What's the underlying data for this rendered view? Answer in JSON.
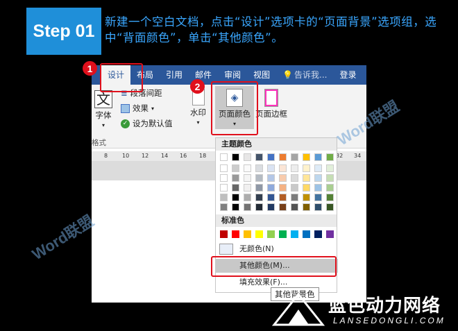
{
  "step": {
    "badge": "Step 01",
    "instruction": "新建一个空白文档，点击“设计”选项卡的“页面背景”选项组，选中“背面颜色”，单击“其他颜色”。"
  },
  "tabs": [
    "设计",
    "布局",
    "引用",
    "邮件",
    "审阅",
    "视图"
  ],
  "tell_me": "告诉我...",
  "login": "登录",
  "ribbon": {
    "font_label": "字体",
    "para_spacing": "段落间距",
    "effects": "效果",
    "set_default": "设为默认值",
    "group_label": "格式",
    "watermark": "水印",
    "page_color": "页面颜色",
    "page_border": "页面边框"
  },
  "ruler_ticks": [
    "8",
    "10",
    "12",
    "14",
    "16",
    "18",
    "32",
    "34"
  ],
  "dropdown": {
    "theme_header": "主题颜色",
    "standard_header": "标准色",
    "no_color": "无颜色(N)",
    "more_colors": "其他颜色(M)...",
    "fill_effects": "填充效果(F)..."
  },
  "theme_colors_top": [
    "#ffffff",
    "#000000",
    "#e7e6e6",
    "#44546a",
    "#4472c4",
    "#ed7d31",
    "#a5a5a5",
    "#ffc000",
    "#5b9bd5",
    "#70ad47"
  ],
  "standard_colors": [
    "#c00000",
    "#ff0000",
    "#ffc000",
    "#ffff00",
    "#92d050",
    "#00b050",
    "#00b0f0",
    "#0070c0",
    "#002060",
    "#7030a0"
  ],
  "tooltip": "其他背景色",
  "markers": [
    "1",
    "2"
  ],
  "watermark_text": "Word联盟",
  "brand": {
    "name": "蓝色动力网络",
    "site": "LANSEDONGLI.COM"
  },
  "accent_colors": {
    "step_badge": "#1f8fd9",
    "highlight": "#e0101c",
    "ribbon": "#2b579a"
  }
}
